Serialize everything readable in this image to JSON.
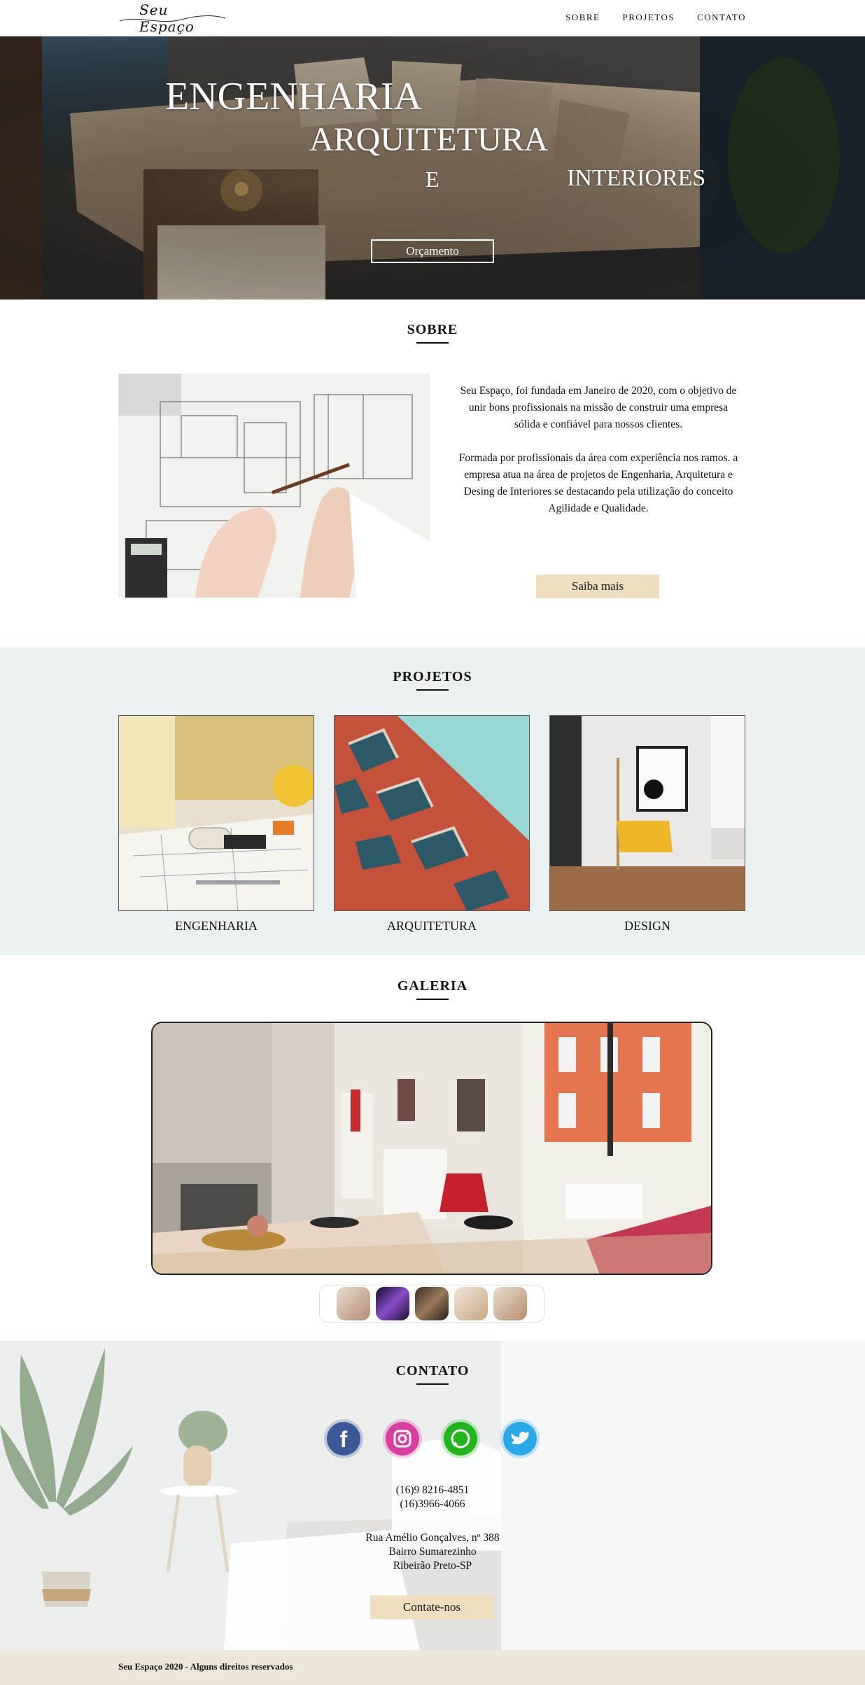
{
  "nav": {
    "logo": "Seu Espaço",
    "links": [
      "SOBRE",
      "PROJETOS",
      "CONTATO"
    ]
  },
  "hero": {
    "line1": "ENGENHARIA",
    "line2": "ARQUITETURA",
    "line3": "E",
    "line4": "INTERIORES",
    "button": "Orçamento"
  },
  "sobre": {
    "title": "SOBRE",
    "p1": "Seu Espaço, foi fundada em Janeiro de 2020, com o objetivo de unir bons profissionais na missão de construir uma empresa sólida e confiável para nossos clientes.",
    "p2": "Formada por profissionais da área com experiência nos ramos. a empresa atua na área de projetos de Engenharia, Arquitetura e Desing de Interiores se destacando pela utilização do conceito Agilidade e Qualidade.",
    "button": "Saiba mais"
  },
  "projetos": {
    "title": "PROJETOS",
    "items": [
      "ENGENHARIA",
      "ARQUITETURA",
      "DESIGN"
    ]
  },
  "galeria": {
    "title": "GALERIA"
  },
  "contato": {
    "title": "CONTATO",
    "social": [
      "facebook-icon",
      "instagram-icon",
      "whatsapp-icon",
      "twitter-icon"
    ],
    "phone1": "(16)9 8216-4851",
    "phone2": "(16)3966-4066",
    "addr1": "Rua Amélio Gonçalves, nº 388",
    "addr2": "Bairro Sumarezinho",
    "addr3": "Ribeirão Preto-SP",
    "button": "Contate-nos"
  },
  "footer": {
    "text": "Seu Espaço 2020 - Alguns direitos reservados"
  },
  "colors": {
    "beige": "#efdfbf",
    "projetos_bg": "#ebf0f0",
    "footer_bg": "#ece6db"
  }
}
